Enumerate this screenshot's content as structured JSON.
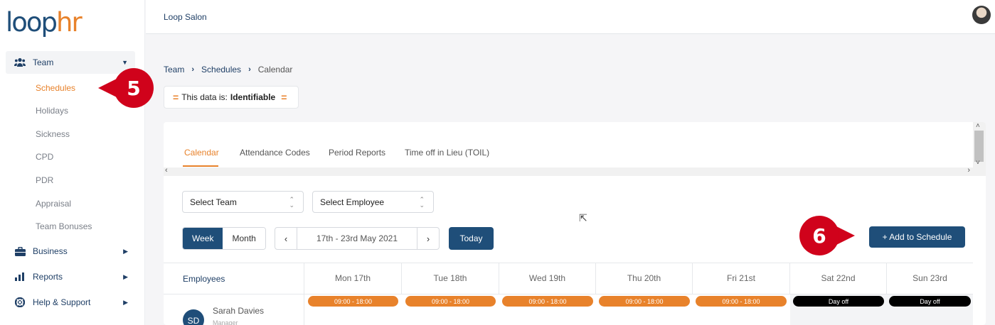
{
  "logo": {
    "part1": "loop",
    "part2": "hr"
  },
  "sidebar": {
    "team": {
      "label": "Team"
    },
    "team_items": [
      {
        "label": "Schedules"
      },
      {
        "label": "Holidays"
      },
      {
        "label": "Sickness"
      },
      {
        "label": "CPD"
      },
      {
        "label": "PDR"
      },
      {
        "label": "Appraisal"
      },
      {
        "label": "Team Bonuses"
      }
    ],
    "business": {
      "label": "Business"
    },
    "reports": {
      "label": "Reports"
    },
    "help": {
      "label": "Help & Support"
    }
  },
  "callouts": {
    "step5": "5",
    "step6": "6"
  },
  "topbar": {
    "org_name": "Loop Salon"
  },
  "breadcrumb": {
    "items": [
      "Team",
      "Schedules",
      "Calendar"
    ]
  },
  "data_classification": {
    "prefix": "This data is:",
    "value": "Identifiable"
  },
  "tabs": [
    {
      "label": "Calendar"
    },
    {
      "label": "Attendance Codes"
    },
    {
      "label": "Period Reports"
    },
    {
      "label": "Time off in Lieu (TOIL)"
    }
  ],
  "filters": {
    "team": "Select Team",
    "employee": "Select Employee"
  },
  "view_toggle": {
    "week": "Week",
    "month": "Month"
  },
  "date_nav": {
    "range": "17th - 23rd May 2021",
    "prev": "‹",
    "next": "›"
  },
  "buttons": {
    "today": "Today",
    "add_to_schedule": "+ Add to Schedule"
  },
  "table": {
    "employees_header": "Employees",
    "days": [
      {
        "label": "Mon 17th",
        "shift": "09:00 - 18:00",
        "type": "work"
      },
      {
        "label": "Tue 18th",
        "shift": "09:00 - 18:00",
        "type": "work"
      },
      {
        "label": "Wed 19th",
        "shift": "09:00 - 18:00",
        "type": "work"
      },
      {
        "label": "Thu 20th",
        "shift": "09:00 - 18:00",
        "type": "work"
      },
      {
        "label": "Fri 21st",
        "shift": "09:00 - 18:00",
        "type": "work"
      },
      {
        "label": "Sat 22nd",
        "shift": "Day off",
        "type": "off"
      },
      {
        "label": "Sun 23rd",
        "shift": "Day off",
        "type": "off"
      }
    ],
    "employees": [
      {
        "initials": "SD",
        "name": "Sarah Davies",
        "role": "Manager"
      }
    ]
  },
  "colors": {
    "accent": "#e8822b",
    "primary": "#1f4e79",
    "callout": "#d0021b",
    "day_off": "#000000"
  }
}
